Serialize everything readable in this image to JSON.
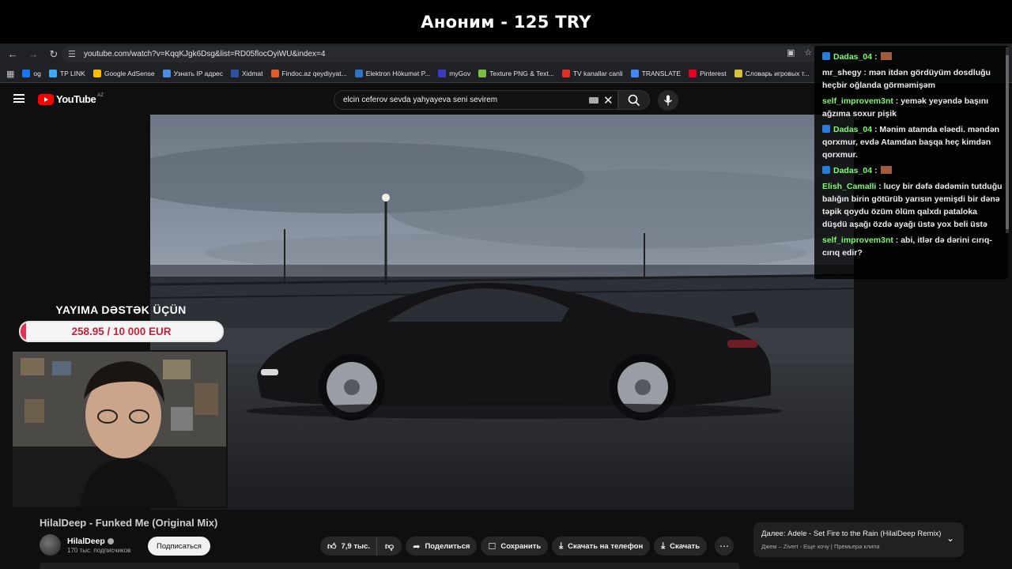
{
  "stream": {
    "banner": "Аноним - 125 TRY"
  },
  "browser": {
    "url": "youtube.com/watch?v=KqqKJgk6Dsg&list=RD05flocOyiWU&index=4",
    "bookmarks": [
      {
        "label": "og",
        "color": "#1877f2"
      },
      {
        "label": "TP LINK",
        "color": "#3fa9f5"
      },
      {
        "label": "Google AdSense",
        "color": "#fbbc04"
      },
      {
        "label": "Узнать IP адрес",
        "color": "#4a8fe0"
      },
      {
        "label": "Xidmat",
        "color": "#2f4fa3"
      },
      {
        "label": "Findoc.az qeydiyyat...",
        "color": "#e05a2b"
      },
      {
        "label": "Elektron Hökumət P...",
        "color": "#2e72c9"
      },
      {
        "label": "myGov",
        "color": "#3b3bbf"
      },
      {
        "label": "Texture PNG & Text...",
        "color": "#7bc043"
      },
      {
        "label": "TV kanallar canli",
        "color": "#e52d27"
      },
      {
        "label": "TRANSLATE",
        "color": "#4285f4"
      },
      {
        "label": "Pinterest",
        "color": "#e60023"
      },
      {
        "label": "Словарь игровых т...",
        "color": "#d8c13a"
      }
    ]
  },
  "youtube": {
    "logo": "YouTube",
    "country": "AZ",
    "search_query": "elcin ceferov sevda yahyayeva seni sevirem"
  },
  "overlay": {
    "donate_title": "YAYIMA DƏSTƏK ÜÇÜN",
    "donate_text": "258.95 / 10 000 EUR",
    "donate_progress": 0.026,
    "accent_color": "#e0334d"
  },
  "video": {
    "title": "HilalDeep - Funked Me (Original Mix)",
    "channel": "HilalDeep",
    "subscribers": "170 тыс. подписчиков",
    "subscribe_label": "Подписаться",
    "likes": "7,9 тыс.",
    "share_label": "Поделиться",
    "save_label": "Сохранить",
    "download_phone_label": "Скачать на телефон",
    "download_label": "Скачать"
  },
  "up_next": {
    "title": "Далее: Adele - Set Fire to the Rain (HilalDeep Remix)",
    "subtitle": "Джем – Zivert - Еще хочу | Премьера клипа"
  },
  "chat": {
    "messages": [
      {
        "user": "Dadas_04",
        "user_color": "#7cfc6b",
        "text": " : ",
        "badge": true,
        "emote": true
      },
      {
        "user": "mr_shegy",
        "user_color": "#ededed",
        "text": " : mən itdən gördüyüm dosdluğu heçbir oğlanda görməmişəm",
        "badge": false
      },
      {
        "user": "self_improvem3nt",
        "user_color": "#7cfc6b",
        "text": " : yemək yeyəndə başını ağzıma soxur pişik",
        "badge": false
      },
      {
        "user": "Dadas_04",
        "user_color": "#7cfc6b",
        "text": " : Mənim atamda eləedi. məndən qorxmur, evdə Atamdan başqa heç kimdən qorxmur.",
        "badge": true
      },
      {
        "user": "Dadas_04",
        "user_color": "#7cfc6b",
        "text": " : ",
        "badge": true,
        "emote": true
      },
      {
        "user": "Elish_Camalli",
        "user_color": "#7cfc6b",
        "text": " : lucy bir dəfə dədəmin tutduğu balığın birin götürüb yarısın yemişdi bir dənə təpik qoydu  özüm ölüm qalxdı pataloka düşdü aşağı özdə ayağı üstə yox beli üstə",
        "badge": false
      },
      {
        "user": "self_improvem3nt",
        "user_color": "#7cfc6b",
        "text": " : abi, itlər də dərini cırıq-cırıq edir?",
        "badge": false
      }
    ]
  }
}
